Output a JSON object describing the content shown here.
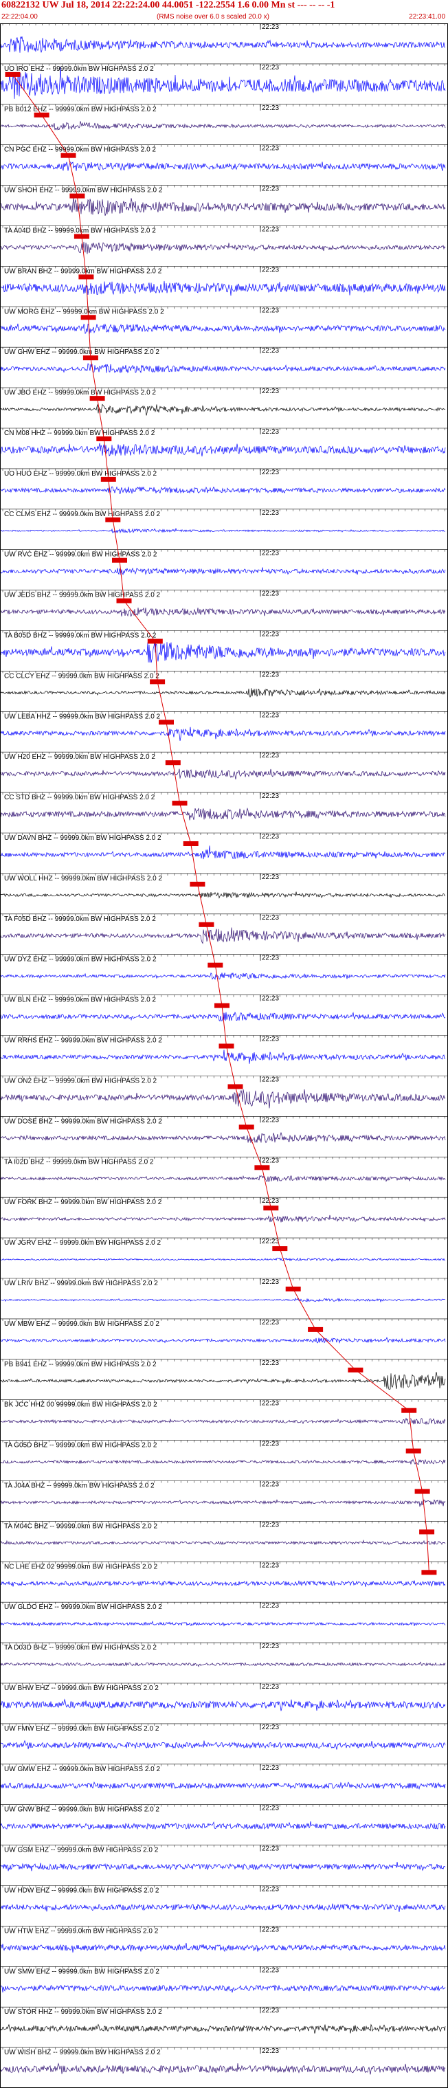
{
  "header": {
    "event_line": "60822132 UW Jul 18, 2014 22:22:24.00   44.0051 -122.2554  1.6 0.00 Mn st --- --  --  -1",
    "start_time": "22:22:04.00",
    "rms_note": "(RMS noise over 6.0 s scaled 20.0 x)",
    "end_time": "22:23:41.00"
  },
  "chart_data": {
    "type": "line",
    "title": "60822132 UW Jul 18, 2014 22:22:24.00   44.0051 -122.2554  1.6 0.00 Mn st --- --  --  -1",
    "x_axis_start": "22:22:04.00",
    "x_axis_end": "22:23:41.00",
    "tick_label": "22:23",
    "grid": false,
    "colors": {
      "blue": "#0000ff",
      "purple": "#2a0a6e",
      "black": "#000000",
      "pick": "#dd0000",
      "pickline": "#dd0000"
    },
    "traces": [
      {
        "label": "",
        "color": "blue",
        "amp": 4,
        "burst_start": 0.02,
        "burst_amp": 14,
        "pick": null
      },
      {
        "label": "UO IRO EHZ -- 99999.0km BW  HIGHPASS  2.0  2",
        "color": "blue",
        "amp": 9,
        "burst_start": 0.02,
        "burst_amp": 22,
        "pick": 0.01
      },
      {
        "label": "PB B012 EHZ -- 99999.0km BW  HIGHPASS  2.0  2",
        "color": "purple",
        "amp": 2,
        "burst_start": 0.12,
        "burst_amp": 6,
        "pick": 0.075
      },
      {
        "label": "CN PGC EHZ -- 99999.0km BW  HIGHPASS  2.0  2",
        "color": "blue",
        "amp": 4,
        "burst_start": 0.14,
        "burst_amp": 7,
        "pick": 0.135
      },
      {
        "label": "UW SHOH EHZ -- 99999.0km BW  HIGHPASS  2.0  2",
        "color": "purple",
        "amp": 5,
        "burst_start": 0.16,
        "burst_amp": 14,
        "pick": 0.155
      },
      {
        "label": "TA A04D BHZ -- 99999.0km BW  HIGHPASS  2.0  2",
        "color": "purple",
        "amp": 3,
        "burst_start": 0.175,
        "burst_amp": 9,
        "pick": 0.165
      },
      {
        "label": "UW BRAN BHZ -- 99999.0km BW  HIGHPASS  2.0  2",
        "color": "blue",
        "amp": 6,
        "burst_start": 0.18,
        "burst_amp": 11,
        "pick": 0.175
      },
      {
        "label": "UW MORG EHZ -- 99999.0km BW  HIGHPASS  2.0  2",
        "color": "blue",
        "amp": 4,
        "burst_start": 0.18,
        "burst_amp": 8,
        "pick": 0.18
      },
      {
        "label": "UW GHW EHZ -- 99999.0km BW  HIGHPASS  2.0  2",
        "color": "blue",
        "amp": 3,
        "burst_start": 0.19,
        "burst_amp": 8,
        "pick": 0.185
      },
      {
        "label": "UW JBO EHZ -- 99999.0km BW  HIGHPASS  2.0  2",
        "color": "black",
        "amp": 2,
        "burst_start": 0.215,
        "burst_amp": 8,
        "pick": 0.2
      },
      {
        "label": "CN M08 HHZ -- 99999.0km BW  HIGHPASS  2.0  2",
        "color": "blue",
        "amp": 5,
        "burst_start": 0.22,
        "burst_amp": 10,
        "pick": 0.215
      },
      {
        "label": "UO HUO EHZ -- 99999.0km BW  HIGHPASS  2.0  2",
        "color": "blue",
        "amp": 3,
        "burst_start": 0.24,
        "burst_amp": 6,
        "pick": 0.225
      },
      {
        "label": "CC CLMS EHZ -- 99999.0km BW  HIGHPASS  2.0  2",
        "color": "blue",
        "amp": 1,
        "burst_start": 0.25,
        "burst_amp": 3,
        "pick": 0.235
      },
      {
        "label": "UW RVC EHZ -- 99999.0km BW  HIGHPASS  2.0  2",
        "color": "blue",
        "amp": 3,
        "burst_start": 0.26,
        "burst_amp": 5,
        "pick": 0.25
      },
      {
        "label": "UW JEDS BHZ -- 99999.0km BW  HIGHPASS  2.0  2",
        "color": "purple",
        "amp": 3,
        "burst_start": 0.27,
        "burst_amp": 7,
        "pick": 0.26
      },
      {
        "label": "TA B05D BHZ -- 99999.0km BW  HIGHPASS  2.0  2",
        "color": "blue",
        "amp": 5,
        "burst_start": 0.33,
        "burst_amp": 18,
        "pick": 0.33
      },
      {
        "label": "CC CLCY EHZ -- 99999.0km BW  HIGHPASS  2.0  2",
        "color": "black",
        "amp": 2,
        "burst_start": 0.55,
        "burst_amp": 7,
        "pick": 0.335
      },
      {
        "label": "UW LEBA HHZ -- 99999.0km BW  HIGHPASS  2.0  2",
        "color": "blue",
        "amp": 3,
        "burst_start": 0.37,
        "burst_amp": 7,
        "pick": 0.355
      },
      {
        "label": "UW H20 EHZ -- 99999.0km BW  HIGHPASS  2.0  2",
        "color": "purple",
        "amp": 3,
        "burst_start": 0.4,
        "burst_amp": 8,
        "pick": 0.37
      },
      {
        "label": "CC STD BHZ -- 99999.0km BW  HIGHPASS  2.0  2",
        "color": "purple",
        "amp": 4,
        "burst_start": 0.42,
        "burst_amp": 10,
        "pick": 0.385
      },
      {
        "label": "UW DAVN BHZ -- 99999.0km BW  HIGHPASS  2.0  2",
        "color": "blue",
        "amp": 3,
        "burst_start": 0.45,
        "burst_amp": 8,
        "pick": 0.41
      },
      {
        "label": "UW WOLL HHZ -- 99999.0km BW  HIGHPASS  2.0  2",
        "color": "black",
        "amp": 2,
        "burst_start": 0.45,
        "burst_amp": 5,
        "pick": 0.425
      },
      {
        "label": "TA F05D BHZ -- 99999.0km BW  HIGHPASS  2.0  2",
        "color": "purple",
        "amp": 3,
        "burst_start": 0.45,
        "burst_amp": 12,
        "pick": 0.445
      },
      {
        "label": "UW DYZ EHZ -- 99999.0km BW  HIGHPASS  2.0  2",
        "color": "blue",
        "amp": 2,
        "burst_start": 0.47,
        "burst_amp": 6,
        "pick": 0.465
      },
      {
        "label": "UW BLN EHZ -- 99999.0km BW  HIGHPASS  2.0  2",
        "color": "blue",
        "amp": 3,
        "burst_start": 0.49,
        "burst_amp": 7,
        "pick": 0.48
      },
      {
        "label": "UW RRHS EHZ -- 99999.0km BW  HIGHPASS  2.0  2",
        "color": "blue",
        "amp": 3,
        "burst_start": 0.5,
        "burst_amp": 7,
        "pick": 0.49
      },
      {
        "label": "UW ON2 EHZ -- 99999.0km BW  HIGHPASS  2.0  2",
        "color": "purple",
        "amp": 4,
        "burst_start": 0.52,
        "burst_amp": 14,
        "pick": 0.51
      },
      {
        "label": "UW DOSE BHZ -- 99999.0km BW  HIGHPASS  2.0  2",
        "color": "purple",
        "amp": 3,
        "burst_start": 0.55,
        "burst_amp": 8,
        "pick": 0.535
      },
      {
        "label": "TA I02D BHZ -- 99999.0km BW  HIGHPASS  2.0  2",
        "color": "purple",
        "amp": 2,
        "burst_start": 0.58,
        "burst_amp": 5,
        "pick": 0.57
      },
      {
        "label": "UW FORK BHZ -- 99999.0km BW  HIGHPASS  2.0  2",
        "color": "purple",
        "amp": 2,
        "burst_start": 0.6,
        "burst_amp": 5,
        "pick": 0.59
      },
      {
        "label": "UW JGRV EHZ -- 99999.0km BW  HIGHPASS  2.0  2",
        "color": "blue",
        "amp": 1,
        "burst_start": 0.62,
        "burst_amp": 2,
        "pick": 0.61
      },
      {
        "label": "UW LRIV BHZ -- 99999.0km BW  HIGHPASS  2.0  2",
        "color": "blue",
        "amp": 1,
        "burst_start": 0.66,
        "burst_amp": 3,
        "pick": 0.64
      },
      {
        "label": "UW MBW EHZ -- 99999.0km BW  HIGHPASS  2.0  2",
        "color": "blue",
        "amp": 2,
        "burst_start": 0.7,
        "burst_amp": 4,
        "pick": 0.69
      },
      {
        "label": "PB B941 EHZ -- 99999.0km BW  HIGHPASS  2.0  2",
        "color": "black",
        "amp": 2,
        "burst_start": 0.86,
        "burst_amp": 14,
        "pick": 0.78
      },
      {
        "label": "BK JCC HHZ 00 99999.0km BW  HIGHPASS  2.0  2",
        "color": "purple",
        "amp": 2,
        "burst_start": 0.9,
        "burst_amp": 5,
        "pick": 0.9
      },
      {
        "label": "TA G05D BHZ -- 99999.0km BW  HIGHPASS  2.0  2",
        "color": "purple",
        "amp": 2,
        "burst_start": 0.92,
        "burst_amp": 4,
        "pick": 0.91
      },
      {
        "label": "TA J04A BHZ -- 99999.0km BW  HIGHPASS  2.0  2",
        "color": "purple",
        "amp": 2,
        "burst_start": 0.94,
        "burst_amp": 4,
        "pick": 0.93
      },
      {
        "label": "TA M04C BHZ -- 99999.0km BW  HIGHPASS  2.0  2",
        "color": "purple",
        "amp": 2,
        "burst_start": 0.95,
        "burst_amp": 3,
        "pick": 0.94
      },
      {
        "label": "NC LHE EHZ 02 99999.0km BW  HIGHPASS  2.0  2",
        "color": "blue",
        "amp": 3,
        "burst_start": 0.96,
        "burst_amp": 4,
        "pick": 0.945
      },
      {
        "label": "UW GLDO EHZ -- 99999.0km BW  HIGHPASS  2.0  2",
        "color": "blue",
        "amp": 2,
        "burst_start": 1.1,
        "burst_amp": 2,
        "pick": null
      },
      {
        "label": "TA D03D BHZ -- 99999.0km BW  HIGHPASS  2.0  2",
        "color": "purple",
        "amp": 2,
        "burst_start": 1.1,
        "burst_amp": 2,
        "pick": null
      },
      {
        "label": "UW BHW EHZ -- 99999.0km BW  HIGHPASS  2.0  2",
        "color": "blue",
        "amp": 5,
        "burst_start": 1.1,
        "burst_amp": 5,
        "pick": null
      },
      {
        "label": "UW FMW EHZ -- 99999.0km BW  HIGHPASS  2.0  2",
        "color": "blue",
        "amp": 4,
        "burst_start": 1.1,
        "burst_amp": 4,
        "pick": null
      },
      {
        "label": "UW GMW EHZ -- 99999.0km BW  HIGHPASS  2.0  2",
        "color": "blue",
        "amp": 4,
        "burst_start": 1.1,
        "burst_amp": 4,
        "pick": null
      },
      {
        "label": "UW GNW BHZ -- 99999.0km BW  HIGHPASS  2.0  2",
        "color": "blue",
        "amp": 4,
        "burst_start": 1.1,
        "burst_amp": 4,
        "pick": null
      },
      {
        "label": "UW GSM EHZ -- 99999.0km BW  HIGHPASS  2.0  2",
        "color": "blue",
        "amp": 4,
        "burst_start": 1.1,
        "burst_amp": 4,
        "pick": null
      },
      {
        "label": "UW HDW EHZ -- 99999.0km BW  HIGHPASS  2.0  2",
        "color": "blue",
        "amp": 4,
        "burst_start": 1.1,
        "burst_amp": 4,
        "pick": null
      },
      {
        "label": "UW HTW EHZ -- 99999.0km BW  HIGHPASS  2.0  2",
        "color": "blue",
        "amp": 4,
        "burst_start": 1.1,
        "burst_amp": 4,
        "pick": null
      },
      {
        "label": "UW SMW EHZ -- 99999.0km BW  HIGHPASS  2.0  2",
        "color": "blue",
        "amp": 4,
        "burst_start": 1.1,
        "burst_amp": 4,
        "pick": null
      },
      {
        "label": "UW STOR HHZ -- 99999.0km BW  HIGHPASS  2.0  2",
        "color": "black",
        "amp": 4,
        "burst_start": 1.1,
        "burst_amp": 4,
        "pick": null
      },
      {
        "label": "UW WISH BHZ -- 99999.0km BW  HIGHPASS  2.0  2",
        "color": "purple",
        "amp": 5,
        "burst_start": 1.1,
        "burst_amp": 5,
        "pick": null
      }
    ]
  }
}
